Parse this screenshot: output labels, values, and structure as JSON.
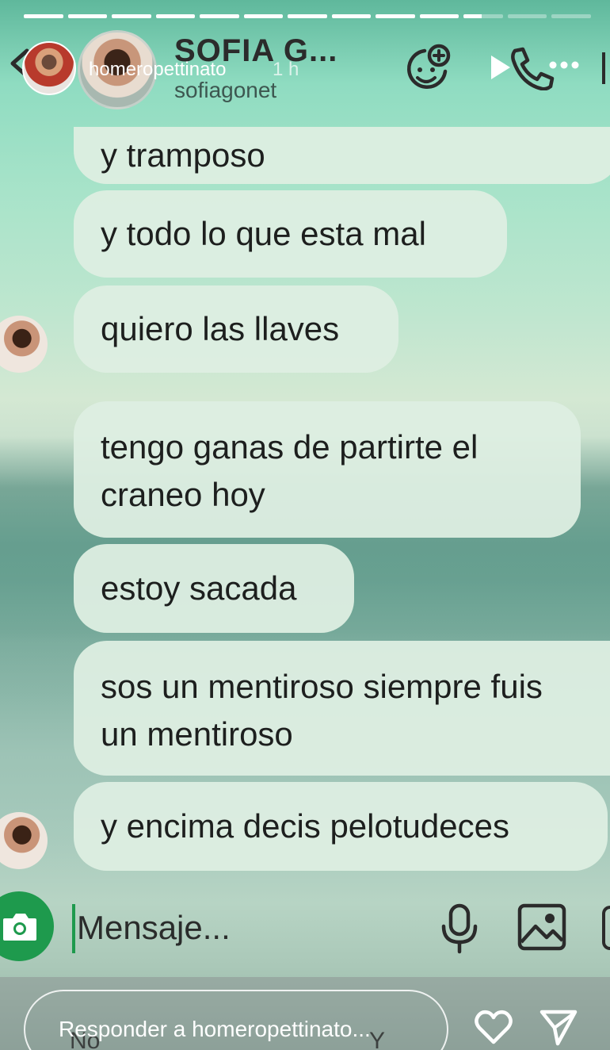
{
  "story": {
    "segments_total": 13,
    "segments_viewed": 10,
    "current_segment_progress": 0.45,
    "user": "homeropettinato",
    "time": "1 h"
  },
  "chat": {
    "name": "SOFIA G...",
    "handle": "sofiagonet"
  },
  "messages": [
    {
      "text": "y tramposo"
    },
    {
      "text": "y todo lo que esta mal"
    },
    {
      "text": "quiero las llaves"
    },
    {
      "text": "tengo ganas de partirte el\ncraneo hoy"
    },
    {
      "text": "estoy sacada"
    },
    {
      "text": "sos un mentiroso siempre fuis\nun mentiroso"
    },
    {
      "text": "y encima decis pelotudeces"
    }
  ],
  "composer": {
    "placeholder": "Mensaje..."
  },
  "reply": {
    "placeholder": "Responder a homeropettinato...",
    "underlay_left": "No",
    "underlay_right": "Y"
  },
  "icons": {
    "back": "chevron-left-icon",
    "sticker": "sticker-add-icon",
    "play": "play-icon",
    "call": "phone-call-icon",
    "more": "more-dots-icon",
    "camera": "camera-icon",
    "mic": "microphone-icon",
    "image": "image-icon",
    "heart": "heart-icon",
    "send": "send-icon"
  },
  "colors": {
    "bubble": "#ddeee2",
    "accent_green": "#1e9a4d",
    "icon_dark": "#2b2b2b"
  }
}
